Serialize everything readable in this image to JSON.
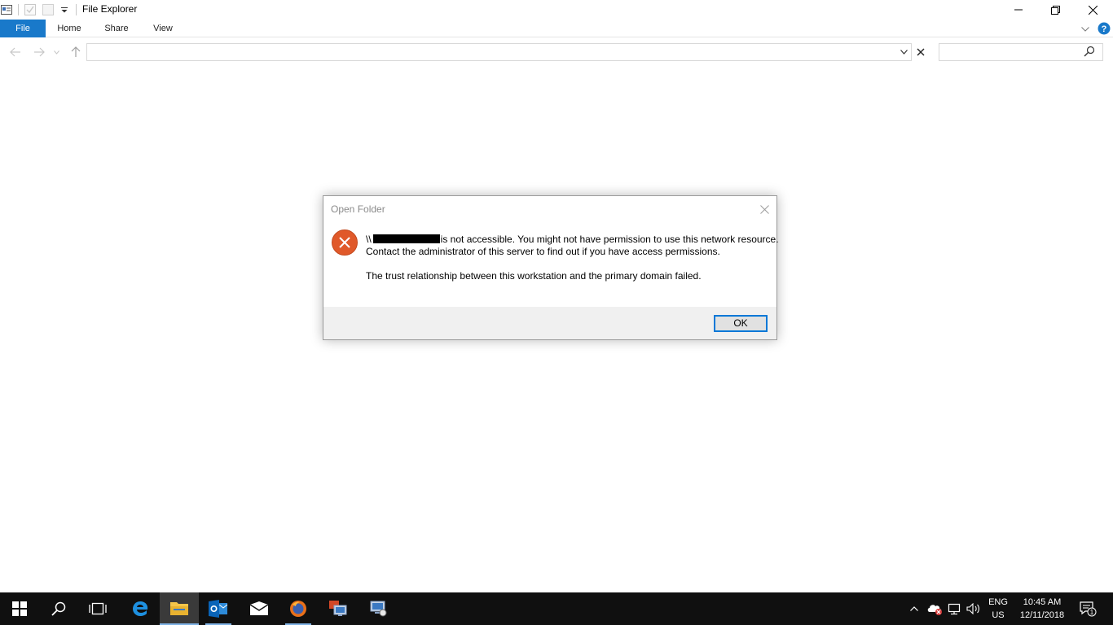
{
  "window": {
    "title": "File Explorer"
  },
  "ribbon": {
    "tabs": [
      {
        "label": "File"
      },
      {
        "label": "Home"
      },
      {
        "label": "Share"
      },
      {
        "label": "View"
      }
    ]
  },
  "address_bar": {
    "value": "",
    "search_placeholder": ""
  },
  "dialog": {
    "title": "Open Folder",
    "path_prefix": "\\\\",
    "message_line1_rest": "is not accessible. You might not have permission to use this network resource.",
    "message_line2": "Contact the administrator of this server to find out if you have access permissions.",
    "message_detail": "The trust relationship between this workstation and the primary domain failed.",
    "ok_label": "OK"
  },
  "taskbar": {
    "language_line1": "ENG",
    "language_line2": "US",
    "time": "10:45 AM",
    "date": "12/11/2018",
    "notification_count": "1"
  },
  "colors": {
    "accent": "#1979ca",
    "error_icon": "#e0592a",
    "taskbar": "#101010",
    "dialog_footer": "#f0f0f0"
  }
}
